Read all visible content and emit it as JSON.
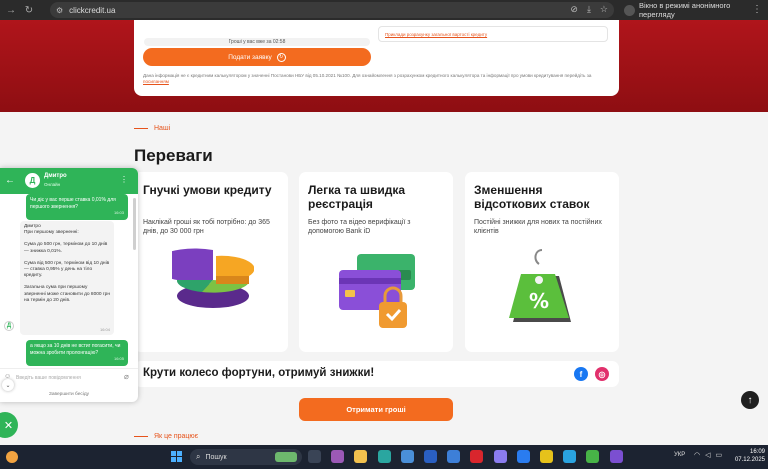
{
  "browser": {
    "url": "clickcredit.ua",
    "incognito_label": "Вікно в режимі анонімного перегляду"
  },
  "calculator": {
    "note": "Гроші у вас вже за 02:58",
    "apply_label": "Подати заявку",
    "right_link": "Приклади розрахунку загальної вартості кредиту",
    "disclaimer": "Дана інформація не є кредитним калькулятором у значенні Постанови НБУ від 05.10.2021 №100. Для ознайомлення з розрахунком кредитного калькулятора та інформації про умови кредитування перейдіть за",
    "disclaimer_link": "посиланням"
  },
  "advantages": {
    "tag": "Наші",
    "title": "Переваги",
    "cards": [
      {
        "title": "Гнучкі умови кредиту",
        "text": "Наклікай гроші як тобі потрібно: до 365 днів, до 30 000 грн",
        "icon": "pie-chart-icon"
      },
      {
        "title": "Легка та швидка реєстрація",
        "text": "Без фото та відео верифікації з допомогою Bank iD",
        "icon": "cards-lock-icon"
      },
      {
        "title": "Зменшення відсоткових ставок",
        "text": "Постійні знижки для нових та постійних клієнтів",
        "icon": "discount-tag-icon"
      }
    ]
  },
  "wheel": {
    "text": "Крути колесо фортуни, отримуй знижки!",
    "facebook": "f",
    "instagram": "◎"
  },
  "cta": {
    "label": "Отримати гроші"
  },
  "how": {
    "tag": "Як це працює"
  },
  "chat": {
    "avatar_letter": "Д",
    "name": "Дмитро",
    "status": "Онлайн",
    "msg1": "Чи діє у вас перше ставка 0,01% для першого звернення?",
    "msg1_time": "16:03",
    "reply_lines": [
      "Дмитро",
      "При першому зверненні:",
      "",
      "Сума до 500 грн, терміном до 10 днів — знижка 0,01%.",
      "",
      "Сума від 500 грн, терміном від 10 днів — ставка 0,95% у день на тіло кредиту.",
      "",
      "Загальна сума при першому зверненні може становити до 8000 грн на термін до 20 днів."
    ],
    "reply_time": "16:04",
    "msg2": "а якщо за 10 днів не встиг погасити, чи можна зробити пролонгацію?",
    "msg2_time": "16:05",
    "input_placeholder": "Введіть ваше повідомлення",
    "finish_label": "Завершити бесіду"
  },
  "taskbar": {
    "search_label": "Пошук",
    "lang": "УКР",
    "time": "16:09",
    "date": "07.12.2025",
    "apps": [
      {
        "name": "task-view-icon",
        "color": "#3a4456"
      },
      {
        "name": "widgets-icon",
        "color": "#9b59b6"
      },
      {
        "name": "file-explorer-icon",
        "color": "#f2c14e"
      },
      {
        "name": "edge-icon",
        "color": "#2aa6a0"
      },
      {
        "name": "store-icon",
        "color": "#4a8fd8"
      },
      {
        "name": "app-l-icon",
        "color": "#2a5fc2"
      },
      {
        "name": "mail-icon",
        "color": "#3d7fd8"
      },
      {
        "name": "opera-icon",
        "color": "#d9262d"
      },
      {
        "name": "meta-icon",
        "color": "#8a7cf0"
      },
      {
        "name": "dropbox-icon",
        "color": "#2a7cf0"
      },
      {
        "name": "chrome-icon",
        "color": "#e6c21b"
      },
      {
        "name": "telegram-icon",
        "color": "#2aa3e0"
      },
      {
        "name": "app-green-icon",
        "color": "#47b347"
      },
      {
        "name": "viber-icon",
        "color": "#7b4fd1"
      }
    ]
  },
  "colors": {
    "brand_orange": "#f36b1f",
    "brand_red": "#b0151b",
    "chat_green": "#2fb458"
  }
}
